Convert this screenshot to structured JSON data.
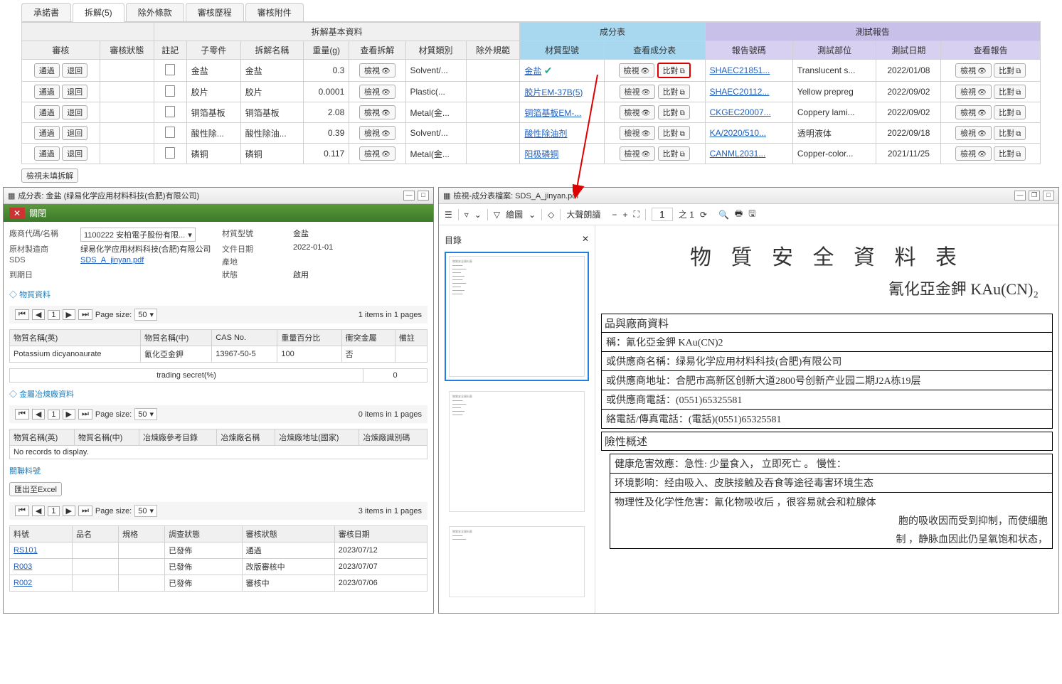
{
  "tabs": [
    "承諾書",
    "拆解(5)",
    "除外條款",
    "審核歷程",
    "審核附件"
  ],
  "active_tab": 1,
  "header_groups": {
    "basic": "拆解基本資料",
    "comp": "成分表",
    "test": "測試報告"
  },
  "columns": {
    "audit": "審核",
    "status": "審核狀態",
    "note": "註記",
    "child": "子零件",
    "name": "拆解名稱",
    "weight": "重量(g)",
    "view_split": "查看拆解",
    "mat_type": "材質類別",
    "exclude": "除外規範",
    "mat_model": "材質型號",
    "view_comp": "查看成分表",
    "report_no": "報告號碼",
    "test_part": "測試部位",
    "test_date": "測試日期",
    "view_report": "查看報告"
  },
  "btn": {
    "pass": "通過",
    "reject": "退回",
    "view": "檢視",
    "compare": "比對"
  },
  "rows": [
    {
      "child": "金盐",
      "name": "金盐",
      "weight": "0.3",
      "mat_type": "Solvent/...",
      "mat_model": "金盐",
      "check": true,
      "report": "SHAEC21851...",
      "part": "Translucent s...",
      "date": "2022/01/08"
    },
    {
      "child": "胶片",
      "name": "胶片",
      "weight": "0.0001",
      "mat_type": "Plastic(...",
      "mat_model": "胶片EM-37B(5)",
      "report": "SHAEC20112...",
      "part": "Yellow prepreg",
      "date": "2022/09/02"
    },
    {
      "child": "铜箔基板",
      "name": "铜箔基板",
      "weight": "2.08",
      "mat_type": "Metal(金...",
      "mat_model": "铜箔基板EM-...",
      "report": "CKGEC20007...",
      "part": "Coppery lami...",
      "date": "2022/09/02"
    },
    {
      "child": "酸性除...",
      "name": "酸性除油...",
      "weight": "0.39",
      "mat_type": "Solvent/...",
      "mat_model": "酸性除油剂",
      "report": "KA/2020/510...",
      "part": "透明液体",
      "date": "2022/09/18"
    },
    {
      "child": "磷铜",
      "name": "磷铜",
      "weight": "0.117",
      "mat_type": "Metal(金...",
      "mat_model": "阳极磷铜",
      "report": "CANML2031...",
      "part": "Copper-color...",
      "date": "2021/11/25"
    }
  ],
  "bottom_btn": "檢視未填拆解",
  "left_panel": {
    "title": "成分表: 金盐 (绿易化学应用材料科技(合肥)有限公司)",
    "close": "關閉",
    "vendor_code_lbl": "廠商代碼/名稱",
    "vendor_code": "1100222 安柏電子股份有限...",
    "mat_model_lbl": "材質型號",
    "mat_model": "金盐",
    "orig_mfr_lbl": "原材製造商",
    "orig_mfr": "绿易化学应用材料科技(合肥)有限公司",
    "doc_date_lbl": "文件日期",
    "doc_date": "2022-01-01",
    "sds_lbl": "SDS",
    "sds_link": "SDS_A_jinyan.pdf",
    "origin_lbl": "產地",
    "expiry_lbl": "到期日",
    "status_lbl": "狀態",
    "status_val": "啟用",
    "sec_material": "物質資料",
    "page_size_lbl": "Page size:",
    "page_size": "50",
    "items1": "1 items in 1 pages",
    "mat_cols": {
      "en": "物質名稱(英)",
      "zh": "物質名稱(中)",
      "cas": "CAS No.",
      "pct": "重量百分比",
      "decl": "衝突金屬",
      "note": "備註"
    },
    "mat_row": {
      "en": "Potassium dicyanoaurate",
      "zh": "氰化亞金鉀",
      "cas": "13967-50-5",
      "pct": "100",
      "decl": "否"
    },
    "trading": "trading secret(%)",
    "trading_val": "0",
    "sec_smelter": "金屬冶煉廠資料",
    "items0": "0 items in 1 pages",
    "smelt_cols": {
      "en": "物質名稱(英)",
      "zh": "物質名稱(中)",
      "ref": "冶煉廠參考目錄",
      "name": "冶煉廠名稱",
      "country": "冶煉廠地址(國家)",
      "id": "冶煉廠識別碼"
    },
    "no_records": "No records to display.",
    "sec_related": "關聯料號",
    "export": "匯出至Excel",
    "items3": "3 items in 1 pages",
    "rel_cols": {
      "pn": "料號",
      "prod": "品名",
      "spec": "規格",
      "inv": "調查狀態",
      "audit": "審核狀態",
      "date": "審核日期"
    },
    "rel_rows": [
      {
        "pn": "RS101",
        "inv": "已發佈",
        "audit": "通過",
        "date": "2023/07/12"
      },
      {
        "pn": "R003",
        "inv": "已發佈",
        "audit": "改版審核中",
        "date": "2023/07/07"
      },
      {
        "pn": "R002",
        "inv": "已發佈",
        "audit": "審核中",
        "date": "2023/07/06"
      }
    ]
  },
  "right_panel": {
    "title": "檢視-成分表檔案: SDS_A_jinyan.pdf",
    "toc": "目錄",
    "draw": "繪圖",
    "read": "大聲朗讀",
    "page": "1",
    "zoom": "之 1",
    "h1": "物 質 安 全 資 料 表",
    "h2": "氰化亞金鉀 KAu(CN)₂",
    "sec1": "品與廠商資料",
    "r1": "稱：氰化亞金鉀 KAu(CN)2",
    "r2": "或供應商名稱：绿易化学应用材料科技(合肥)有限公司",
    "r3": "或供應商地址：合肥市高新区创新大道2800号创新产业园二期J2A栋19层",
    "r4": "或供應商電話：(0551)65325581",
    "r5": "絡電話/傳真電話：(電話)(0551)65325581",
    "sec2": "險性概述",
    "r6": "健康危害效應：急性: 少量食入， 立即死亡 。    慢性：",
    "r7": "环境影响：经由吸入、皮肤接触及吞食等途径毒害环境生态",
    "r8": "物理性及化学性危害：氰化物吸收后 ，很容易就会和粒腺体",
    "r9": "胞的吸收因而受到抑制，而使細胞",
    "r10": "制 ，静脉血因此仍呈氧饱和状态，"
  }
}
